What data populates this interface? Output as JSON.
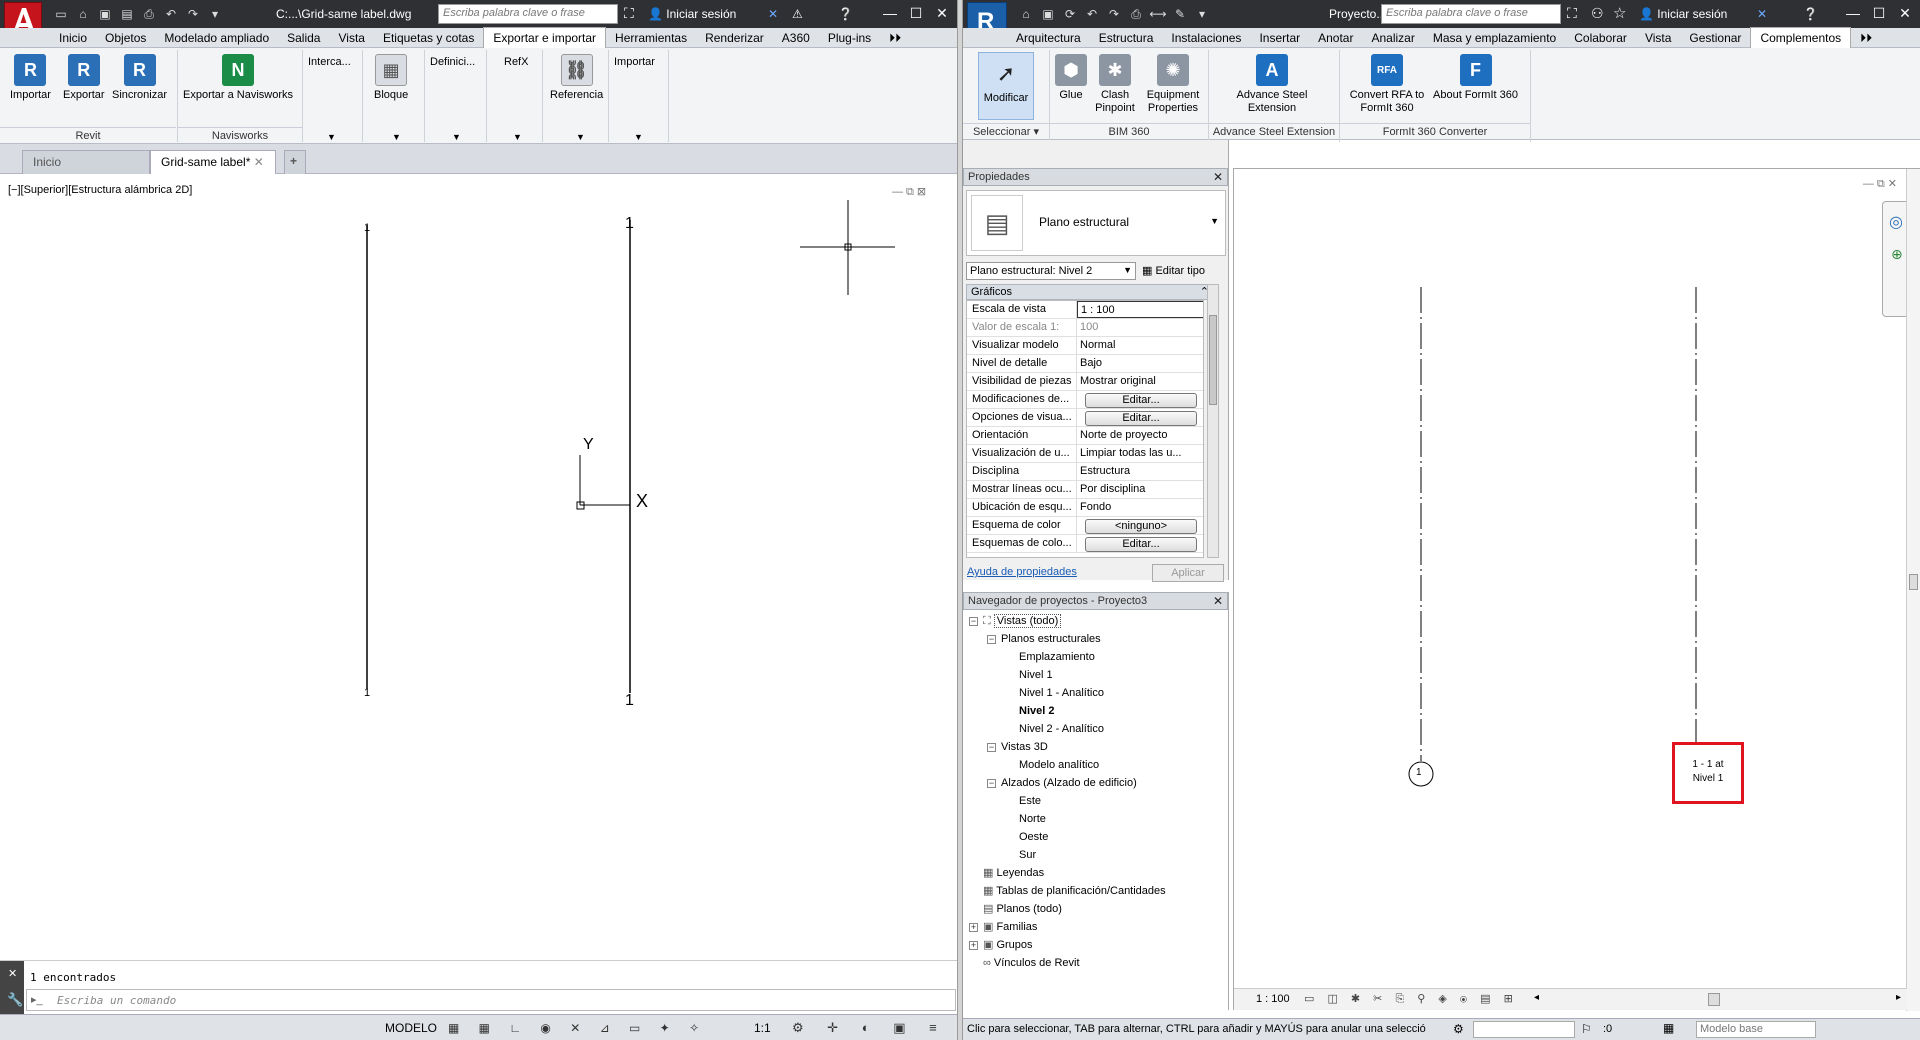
{
  "autocad": {
    "window_title": "C:...\\Grid-same label.dwg",
    "search_placeholder": "Escriba palabra clave o frase",
    "sign_in": "Iniciar sesión",
    "menu": [
      "Inicio",
      "Objetos",
      "Modelado ampliado",
      "Salida",
      "Vista",
      "Etiquetas y cotas",
      "Exportar e importar",
      "Herramientas",
      "Renderizar",
      "A360",
      "Plug-ins"
    ],
    "active_menu": "Exportar e importar",
    "ribbon": {
      "revit_buttons": [
        "Importar",
        "Exportar",
        "Sincronizar"
      ],
      "revit_group": "Revit",
      "navis_button": "Exportar a Navisworks",
      "navis_group": "Navisworks",
      "other_groups": [
        "Interca...",
        "Bloque",
        "Definici...",
        "RefX",
        "Referencia",
        "Importar"
      ]
    },
    "file_tabs": [
      "Inicio",
      "Grid-same label*"
    ],
    "viewport_label": "[−][Superior][Estructura alámbrica 2D]",
    "grid_labels": [
      "1",
      "1",
      "1",
      "1"
    ],
    "ucs_y": "Y",
    "ucs_x": "X",
    "command_history": "1 encontrados",
    "command_placeholder": "Escriba un comando",
    "status": {
      "model": "MODELO",
      "scale": "1:1"
    }
  },
  "revit": {
    "window_title": "Proyecto...",
    "search_placeholder": "Escriba palabra clave o frase",
    "sign_in": "Iniciar sesión",
    "menu": [
      "Arquitectura",
      "Estructura",
      "Instalaciones",
      "Insertar",
      "Anotar",
      "Analizar",
      "Masa y emplazamiento",
      "Colaborar",
      "Vista",
      "Gestionar",
      "Complementos"
    ],
    "active_menu": "Complementos",
    "ribbon": {
      "modify": "Modificar",
      "select_group": "Seleccionar",
      "bim_buttons": [
        "Glue",
        "Clash Pinpoint",
        "Equipment Properties"
      ],
      "bim_group": "BIM 360",
      "advance_button": "Advance Steel Extension",
      "advance_group": "Advance Steel Extension",
      "formit_buttons": [
        "Convert RFA to FormIt 360",
        "About FormIt 360"
      ],
      "formit_group": "FormIt 360 Converter"
    },
    "properties": {
      "title": "Propiedades",
      "type_name": "Plano estructural",
      "instance": "Plano estructural: Nivel 2",
      "edit_type": "Editar tipo",
      "section": "Gráficos",
      "rows": [
        {
          "k": "Escala de vista",
          "v": "1 : 100"
        },
        {
          "k": "Valor de escala    1:",
          "v": "100"
        },
        {
          "k": "Visualizar modelo",
          "v": "Normal"
        },
        {
          "k": "Nivel de detalle",
          "v": "Bajo"
        },
        {
          "k": "Visibilidad de piezas",
          "v": "Mostrar original"
        },
        {
          "k": "Modificaciones de...",
          "v": "Editar..."
        },
        {
          "k": "Opciones de visua...",
          "v": "Editar..."
        },
        {
          "k": "Orientación",
          "v": "Norte de proyecto"
        },
        {
          "k": "Visualización de u...",
          "v": "Limpiar todas las u..."
        },
        {
          "k": "Disciplina",
          "v": "Estructura"
        },
        {
          "k": "Mostrar líneas ocu...",
          "v": "Por disciplina"
        },
        {
          "k": "Ubicación de esqu...",
          "v": "Fondo"
        },
        {
          "k": "Esquema de color",
          "v": "<ninguno>"
        },
        {
          "k": "Esquemas de colo...",
          "v": "Editar..."
        }
      ],
      "help_link": "Ayuda de propiedades",
      "apply": "Aplicar"
    },
    "browser": {
      "title": "Navegador de proyectos - Proyecto3",
      "items": [
        {
          "label": "Vistas (todo)"
        },
        {
          "label": "Planos estructurales"
        },
        {
          "label": "Emplazamiento"
        },
        {
          "label": "Nivel 1"
        },
        {
          "label": "Nivel 1 - Analítico"
        },
        {
          "label": "Nivel 2"
        },
        {
          "label": "Nivel 2 - Analítico"
        },
        {
          "label": "Vistas 3D"
        },
        {
          "label": "Modelo analítico"
        },
        {
          "label": "Alzados (Alzado de edificio)"
        },
        {
          "label": "Este"
        },
        {
          "label": "Norte"
        },
        {
          "label": "Oeste"
        },
        {
          "label": "Sur"
        },
        {
          "label": "Leyendas"
        },
        {
          "label": "Tablas de planificación/Cantidades"
        },
        {
          "label": "Planos (todo)"
        },
        {
          "label": "Familias"
        },
        {
          "label": "Grupos"
        },
        {
          "label": "Vínculos de Revit"
        }
      ]
    },
    "view": {
      "grid_bubble": "1",
      "highlight_label_1": "1 - 1 at",
      "highlight_label_2": "Nivel 1",
      "scale": "1 : 100",
      "highlight_color": "#e0141e"
    },
    "status": {
      "hint": "Clic para seleccionar, TAB para alternar, CTRL para añadir y MAYÚS para anular una selecció",
      "zero": ":0",
      "model_base": "Modelo base"
    }
  }
}
